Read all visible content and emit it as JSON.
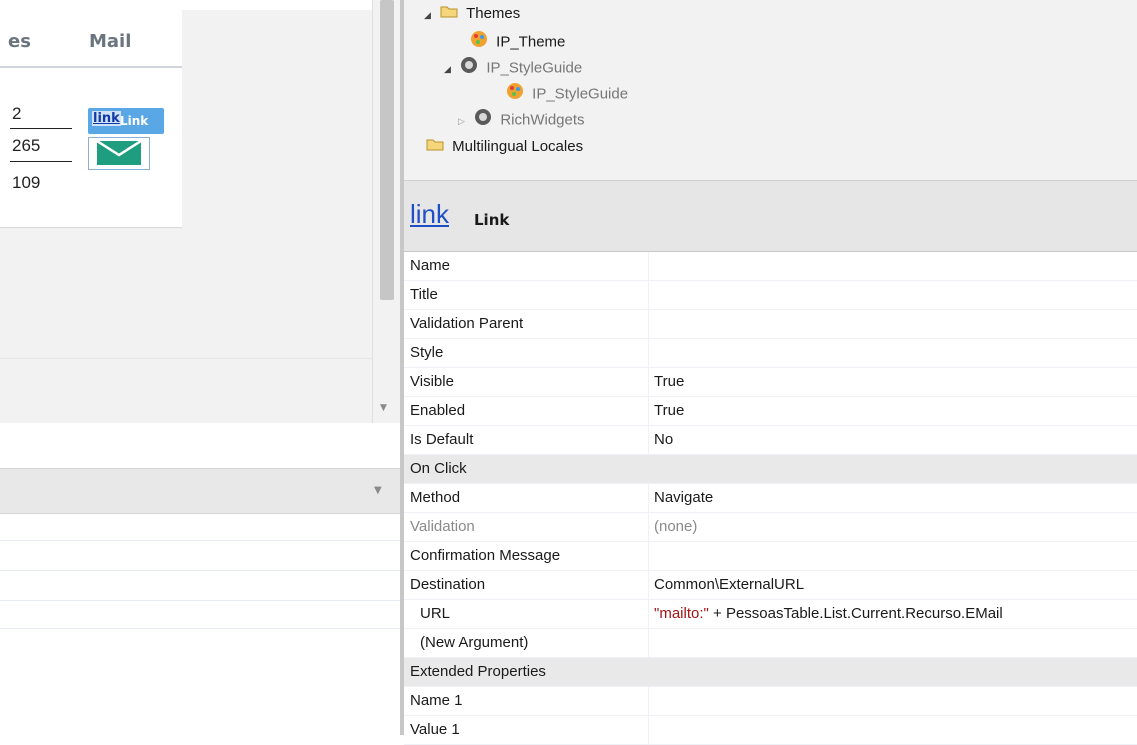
{
  "canvas": {
    "column_headers": [
      "es",
      "Mail"
    ],
    "numbers": [
      "2",
      "265",
      "109"
    ],
    "link_widget": {
      "link_glyph": "link",
      "label": "Link"
    }
  },
  "tree": {
    "items": [
      {
        "label": "Themes",
        "icon": "folder-icon"
      },
      {
        "label": "IP_Theme",
        "icon": "theme-palette-icon"
      },
      {
        "label": "IP_StyleGuide",
        "icon": "module-icon"
      },
      {
        "label": "IP_StyleGuide",
        "icon": "theme-palette-icon"
      },
      {
        "label": "RichWidgets",
        "icon": "module-icon"
      },
      {
        "label": "Multilingual Locales",
        "icon": "folder-icon"
      }
    ]
  },
  "properties": {
    "header": {
      "big": "link",
      "small": "Link"
    },
    "rows": [
      {
        "name": "Name",
        "value": ""
      },
      {
        "name": "Title",
        "value": ""
      },
      {
        "name": "Validation Parent",
        "value": ""
      },
      {
        "name": "Style",
        "value": ""
      },
      {
        "name": "Visible",
        "value": "True"
      },
      {
        "name": "Enabled",
        "value": "True"
      },
      {
        "name": "Is Default",
        "value": "No"
      },
      {
        "name": "On Click",
        "value": ""
      },
      {
        "name": "Method",
        "value": "Navigate"
      },
      {
        "name": "Validation",
        "value": "(none)"
      },
      {
        "name": "Confirmation Message",
        "value": ""
      },
      {
        "name": "Destination",
        "value": "Common\\ExternalURL"
      },
      {
        "name": "URL",
        "value_string": "\"mailto:\"",
        "value_rest": " + PessoasTable.List.Current.Recurso.EMail"
      },
      {
        "name": "(New Argument)",
        "value": ""
      },
      {
        "name": "Extended Properties",
        "value": ""
      },
      {
        "name": "Name 1",
        "value": ""
      },
      {
        "name": "Value 1",
        "value": ""
      }
    ]
  },
  "colors": {
    "link_blue": "#1e4fc6",
    "string_red": "#a31515",
    "mail_green": "#1f9e7f",
    "link_widget_bg": "#5aa7e6"
  }
}
